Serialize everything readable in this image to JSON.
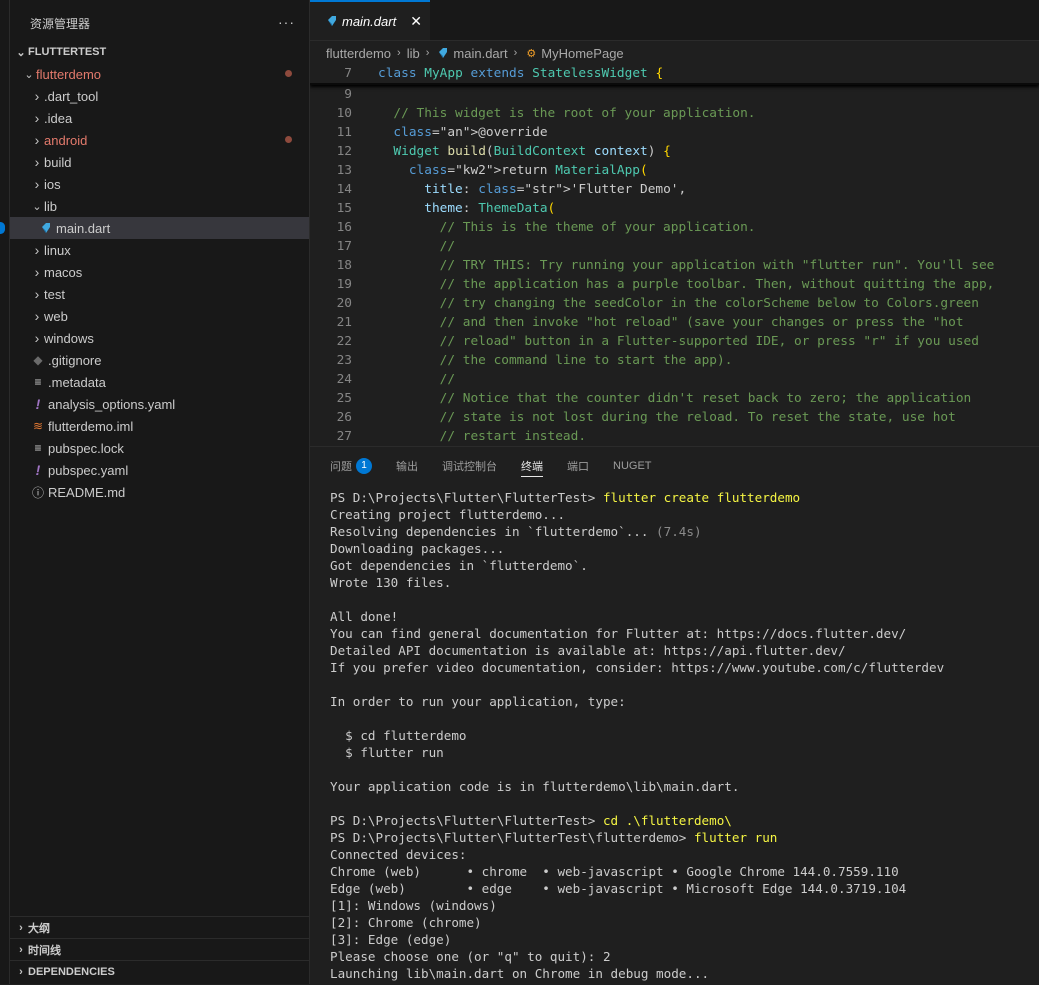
{
  "sidebar": {
    "title": "资源管理器",
    "more": "···",
    "project": "FLUTTERTEST",
    "items": [
      {
        "label": "flutterdemo",
        "type": "folder-open",
        "modified": true
      },
      {
        "label": ".dart_tool",
        "type": "folder"
      },
      {
        "label": ".idea",
        "type": "folder"
      },
      {
        "label": "android",
        "type": "folder",
        "modified": true
      },
      {
        "label": "build",
        "type": "folder"
      },
      {
        "label": "ios",
        "type": "folder"
      },
      {
        "label": "lib",
        "type": "folder-open"
      },
      {
        "label": "main.dart",
        "type": "dart-file",
        "selected": true
      },
      {
        "label": "linux",
        "type": "folder"
      },
      {
        "label": "macos",
        "type": "folder"
      },
      {
        "label": "test",
        "type": "folder"
      },
      {
        "label": "web",
        "type": "folder"
      },
      {
        "label": "windows",
        "type": "folder"
      },
      {
        "label": ".gitignore",
        "type": "git-file"
      },
      {
        "label": ".metadata",
        "type": "lines-file"
      },
      {
        "label": "analysis_options.yaml",
        "type": "yaml-file"
      },
      {
        "label": "flutterdemo.iml",
        "type": "rss-file"
      },
      {
        "label": "pubspec.lock",
        "type": "lines-file"
      },
      {
        "label": "pubspec.yaml",
        "type": "yaml-file"
      },
      {
        "label": "README.md",
        "type": "info-file"
      }
    ],
    "sections": [
      "大纲",
      "时间线",
      "DEPENDENCIES"
    ]
  },
  "editor": {
    "tab_label": "main.dart",
    "breadcrumb": [
      "flutterdemo",
      "lib",
      "main.dart",
      "MyHomePage"
    ],
    "sticky": {
      "num": "7",
      "text": "class MyApp extends StatelessWidget {"
    },
    "lines": [
      {
        "num": "9",
        "text": ""
      },
      {
        "num": "10",
        "text": "  // This widget is the root of your application."
      },
      {
        "num": "11",
        "text": "  @override"
      },
      {
        "num": "12",
        "text": "  Widget build(BuildContext context) {"
      },
      {
        "num": "13",
        "text": "    return MaterialApp("
      },
      {
        "num": "14",
        "text": "      title: 'Flutter Demo',"
      },
      {
        "num": "15",
        "text": "      theme: ThemeData("
      },
      {
        "num": "16",
        "text": "        // This is the theme of your application."
      },
      {
        "num": "17",
        "text": "        //"
      },
      {
        "num": "18",
        "text": "        // TRY THIS: Try running your application with \"flutter run\". You'll see"
      },
      {
        "num": "19",
        "text": "        // the application has a purple toolbar. Then, without quitting the app,"
      },
      {
        "num": "20",
        "text": "        // try changing the seedColor in the colorScheme below to Colors.green"
      },
      {
        "num": "21",
        "text": "        // and then invoke \"hot reload\" (save your changes or press the \"hot"
      },
      {
        "num": "22",
        "text": "        // reload\" button in a Flutter-supported IDE, or press \"r\" if you used"
      },
      {
        "num": "23",
        "text": "        // the command line to start the app)."
      },
      {
        "num": "24",
        "text": "        //"
      },
      {
        "num": "25",
        "text": "        // Notice that the counter didn't reset back to zero; the application"
      },
      {
        "num": "26",
        "text": "        // state is not lost during the reload. To reset the state, use hot"
      },
      {
        "num": "27",
        "text": "        // restart instead."
      }
    ]
  },
  "panel": {
    "tabs": [
      "问题",
      "输出",
      "调试控制台",
      "终端",
      "端口",
      "NUGET"
    ],
    "problems_count": "1",
    "active_tab": "终端",
    "terminal": [
      {
        "prompt": "PS D:\\Projects\\Flutter\\FlutterTest> ",
        "cmd": "flutter create flutterdemo"
      },
      {
        "text": "Creating project flutterdemo..."
      },
      {
        "text": "Resolving dependencies in `flutterdemo`... ",
        "dim": "(7.4s)"
      },
      {
        "text": "Downloading packages..."
      },
      {
        "text": "Got dependencies in `flutterdemo`."
      },
      {
        "text": "Wrote 130 files."
      },
      {
        "text": ""
      },
      {
        "text": "All done!"
      },
      {
        "text": "You can find general documentation for Flutter at: https://docs.flutter.dev/"
      },
      {
        "text": "Detailed API documentation is available at: https://api.flutter.dev/"
      },
      {
        "text": "If you prefer video documentation, consider: https://www.youtube.com/c/flutterdev"
      },
      {
        "text": ""
      },
      {
        "text": "In order to run your application, type:"
      },
      {
        "text": ""
      },
      {
        "text": "  $ cd flutterdemo"
      },
      {
        "text": "  $ flutter run"
      },
      {
        "text": ""
      },
      {
        "text": "Your application code is in flutterdemo\\lib\\main.dart."
      },
      {
        "text": ""
      },
      {
        "prompt": "PS D:\\Projects\\Flutter\\FlutterTest> ",
        "cmd": "cd .\\flutterdemo\\"
      },
      {
        "prompt": "PS D:\\Projects\\Flutter\\FlutterTest\\flutterdemo> ",
        "cmd": "flutter run"
      },
      {
        "text": "Connected devices:"
      },
      {
        "text": "Chrome (web)      • chrome  • web-javascript • Google Chrome 144.0.7559.110"
      },
      {
        "text": "Edge (web)        • edge    • web-javascript • Microsoft Edge 144.0.3719.104"
      },
      {
        "text": "[1]: Windows (windows)"
      },
      {
        "text": "[2]: Chrome (chrome)"
      },
      {
        "text": "[3]: Edge (edge)"
      },
      {
        "text": "Please choose one (or \"q\" to quit): 2"
      },
      {
        "text": "Launching lib\\main.dart on Chrome in debug mode..."
      }
    ]
  },
  "colors": {
    "accent": "#0078d4",
    "modified": "#e37a6c",
    "command": "#f5f543"
  }
}
